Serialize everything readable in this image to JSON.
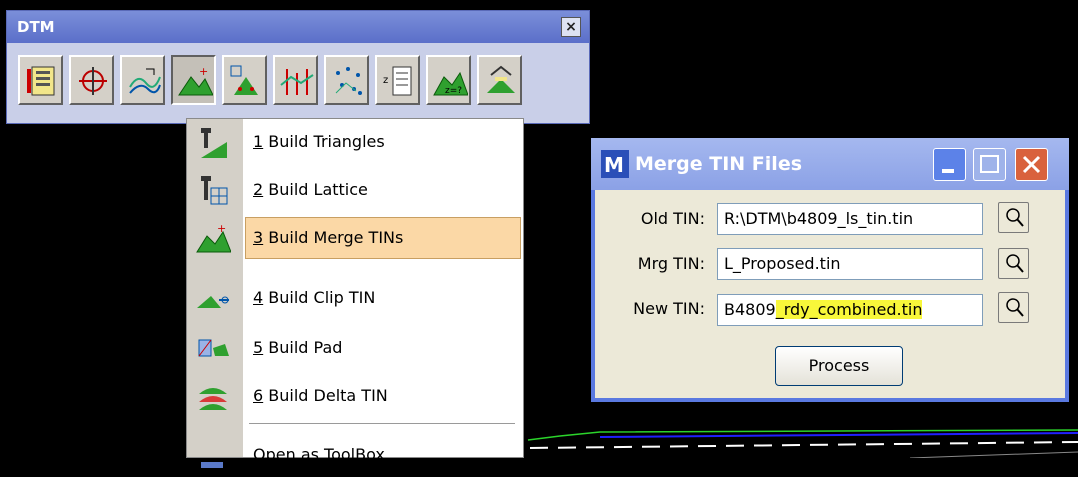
{
  "dtm_toolbar": {
    "title": "DTM",
    "close_glyph": "×",
    "tools": [
      {
        "icon": "load-dtm-icon"
      },
      {
        "icon": "edit-dtm-icon"
      },
      {
        "icon": "contours-icon"
      },
      {
        "icon": "build-tin-icon",
        "active": true
      },
      {
        "icon": "lattice-icon"
      },
      {
        "icon": "profile-icon"
      },
      {
        "icon": "points-icon"
      },
      {
        "icon": "report-icon"
      },
      {
        "icon": "analysis-icon"
      },
      {
        "icon": "export-icon"
      }
    ]
  },
  "build_menu": {
    "items": [
      {
        "num": "1",
        "label": " Build Triangles",
        "icon": "build-triangles-icon"
      },
      {
        "num": "2",
        "label": " Build Lattice",
        "icon": "build-lattice-icon"
      },
      {
        "num": "3",
        "label": " Build Merge TINs",
        "icon": "merge-tins-icon",
        "highlighted": true
      },
      {
        "num": "4",
        "label": " Build Clip TIN",
        "icon": "clip-tin-icon"
      },
      {
        "num": "5",
        "label": " Build Pad",
        "icon": "build-pad-icon"
      },
      {
        "num": "6",
        "label": " Build Delta TIN",
        "icon": "delta-tin-icon"
      }
    ],
    "footer_label": "Open as ToolBox"
  },
  "merge_dialog": {
    "title": "Merge TIN Files",
    "old_tin_label": "Old TIN:",
    "old_tin_value": "R:\\DTM\\b4809_ls_tin.tin",
    "mrg_tin_label": "Mrg TIN:",
    "mrg_tin_value": "L_Proposed.tin",
    "new_tin_label": "New TIN:",
    "new_tin_value_plain": "B4809",
    "new_tin_value_highlighted": "_rdy_combined.tin",
    "process_label": "Process"
  },
  "colors": {
    "highlight": "#fbd8a6",
    "selection_marker": "#f8f73a",
    "title_blue": "#5b6fc9"
  }
}
